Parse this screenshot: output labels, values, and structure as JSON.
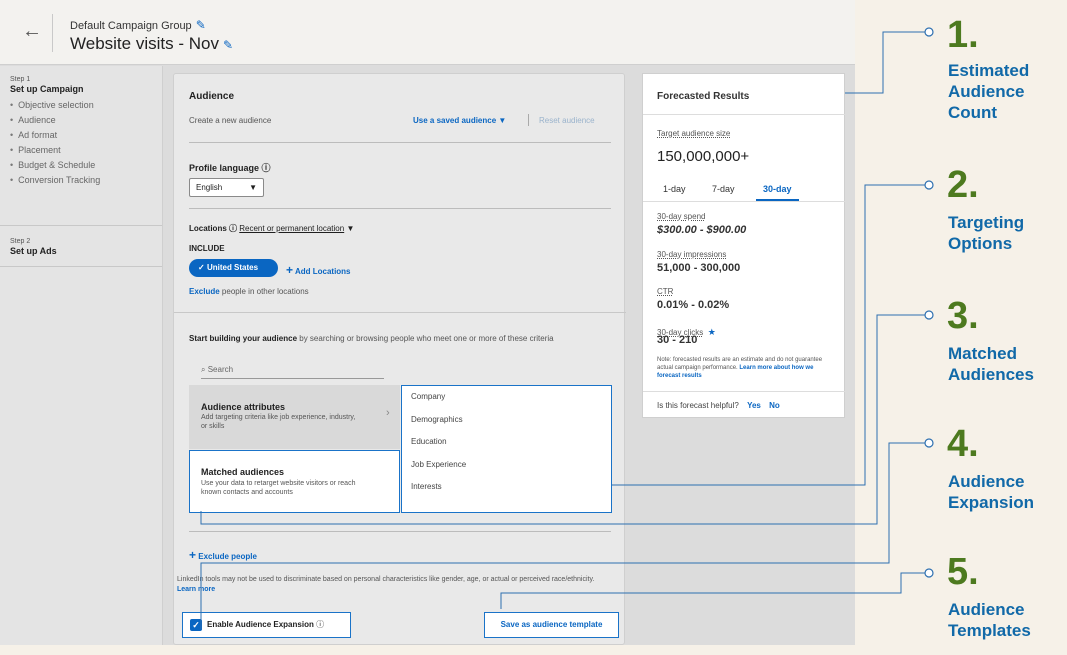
{
  "header": {
    "back_icon": "arrow-left-icon",
    "group_name": "Default Campaign Group",
    "campaign_name": "Website visits - Nov"
  },
  "sidebar": {
    "step1": {
      "num": "Step 1",
      "title": "Set up Campaign",
      "items": [
        "Objective selection",
        "Audience",
        "Ad format",
        "Placement",
        "Budget & Schedule",
        "Conversion Tracking"
      ]
    },
    "step2": {
      "num": "Step 2",
      "title": "Set up Ads"
    }
  },
  "audience": {
    "title": "Audience",
    "create_new": "Create a new audience",
    "use_saved": "Use a saved audience",
    "reset": "Reset audience",
    "profile_language_label": "Profile language",
    "language_value": "English",
    "locations_label": "Locations",
    "location_type": "Recent or permanent location",
    "include": "INCLUDE",
    "location_pill": "United States",
    "add_locations": "Add Locations",
    "exclude_link": "Exclude",
    "exclude_rest": "people in other locations",
    "build_bold": "Start building your audience",
    "build_rest": "by searching or browsing people who meet one or more of these criteria",
    "search_placeholder": "Search",
    "attr_title": "Audience attributes",
    "attr_desc": "Add targeting criteria like job experience, industry, or skills",
    "matched_title": "Matched audiences",
    "matched_desc": "Use your data to retarget website visitors or reach known contacts and accounts",
    "dropdown_items": [
      "Company",
      "Demographics",
      "Education",
      "Job Experience",
      "Interests"
    ],
    "exclude_people": "Exclude people",
    "disclaimer": "LinkedIn tools may not be used to discriminate based on personal characteristics like gender, age, or actual or perceived race/ethnicity.",
    "learn_more": "Learn more",
    "enable_expansion": "Enable Audience Expansion",
    "save_template": "Save as audience template"
  },
  "forecast": {
    "title": "Forecasted Results",
    "target_label": "Target audience size",
    "target_value": "150,000,000+",
    "tabs": [
      "1-day",
      "7-day",
      "30-day"
    ],
    "active_tab": "30-day",
    "spend_label": "30-day spend",
    "spend_value": "$300.00 - $900.00",
    "impressions_label": "30-day impressions",
    "impressions_value": "51,000 - 300,000",
    "ctr_label": "CTR",
    "ctr_value": "0.01% - 0.02%",
    "clicks_label": "30-day clicks",
    "clicks_value": "30 - 210",
    "note": "Note: forecasted results are an estimate and do not guarantee actual campaign performance.",
    "note_link": "Learn more about how we forecast results",
    "helpful_q": "Is this forecast helpful?",
    "yes": "Yes",
    "no": "No"
  },
  "annotations": [
    {
      "num": "1.",
      "label": "Estimated Audience Count"
    },
    {
      "num": "2.",
      "label": "Targeting Options"
    },
    {
      "num": "3.",
      "label": "Matched Audiences"
    },
    {
      "num": "4.",
      "label": "Audience Expansion"
    },
    {
      "num": "5.",
      "label": "Audience Templates"
    }
  ],
  "colors": {
    "accent": "#0a66c2",
    "annotation_number": "#4d7a1f",
    "annotation_label": "#1169a8",
    "background": "#f6f1e8"
  }
}
